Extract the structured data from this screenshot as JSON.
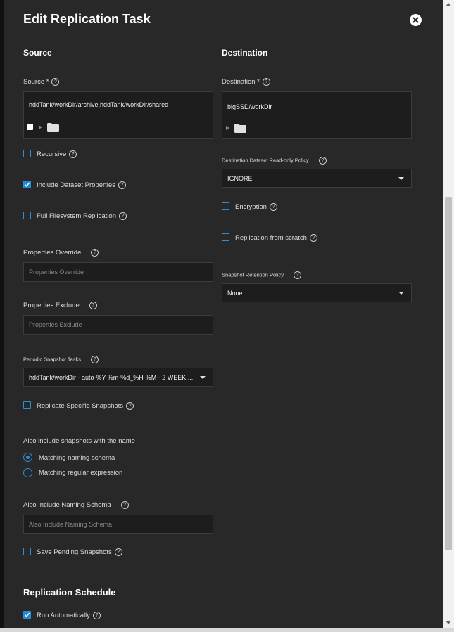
{
  "dialog": {
    "title": "Edit Replication Task"
  },
  "source": {
    "section_title": "Source",
    "source_label": "Source *",
    "source_value": "hddTank/workDir/archive,hddTank/workDir/shared",
    "recursive": {
      "label": "Recursive",
      "checked": false
    },
    "include_dataset_properties": {
      "label": "Include Dataset Properties",
      "checked": true
    },
    "full_filesystem_replication": {
      "label": "Full Filesystem Replication",
      "checked": false
    },
    "properties_override": {
      "label": "Properties Override",
      "placeholder": "Properties Override"
    },
    "properties_exclude": {
      "label": "Properties Exclude",
      "placeholder": "Properties Exclude"
    },
    "periodic_snapshot_tasks": {
      "label": "Periodic Snapshot Tasks",
      "value": "hddTank/workDir - auto-%Y-%m-%d_%H-%M - 2 WEEK ..."
    },
    "replicate_specific_snapshots": {
      "label": "Replicate Specific Snapshots",
      "checked": false
    },
    "also_include": {
      "label": "Also include snapshots with the name",
      "options": [
        "Matching naming schema",
        "Matching regular expression"
      ],
      "selected": "Matching naming schema"
    },
    "also_include_naming_schema": {
      "label": "Also Include Naming Schema",
      "placeholder": "Also Include Naming Schema"
    },
    "save_pending_snapshots": {
      "label": "Save Pending Snapshots",
      "checked": false
    }
  },
  "destination": {
    "section_title": "Destination",
    "destination_label": "Destination *",
    "destination_value": "bigSSD/workDir",
    "readonly_policy": {
      "label": "Destination Dataset Read-only Policy",
      "value": "IGNORE"
    },
    "encryption": {
      "label": "Encryption",
      "checked": false
    },
    "replication_from_scratch": {
      "label": "Replication from scratch",
      "checked": false
    },
    "snapshot_retention_policy": {
      "label": "Snapshot Retention Policy",
      "value": "None"
    }
  },
  "schedule": {
    "section_title": "Replication Schedule",
    "run_automatically": {
      "label": "Run Automatically",
      "checked": true
    }
  },
  "icons": {
    "help": "?",
    "check": "✓",
    "close": "×"
  },
  "colors": {
    "accent": "#1a8bd2",
    "panel": "#282828",
    "input_bg": "#1d1d1d"
  }
}
